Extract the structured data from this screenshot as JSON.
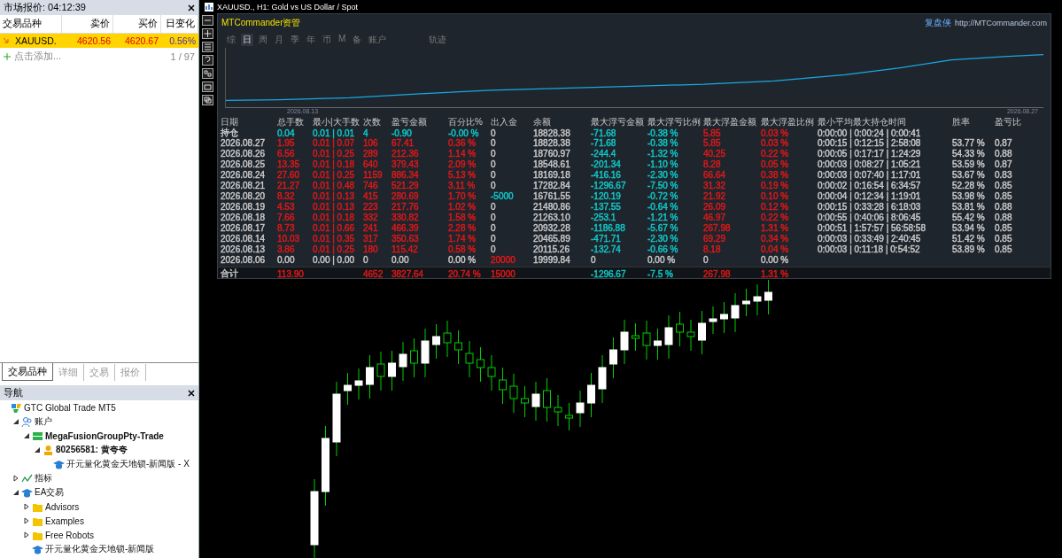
{
  "market_watch": {
    "title": "市场报价: 04:12:39",
    "columns": [
      "交易品种",
      "卖价",
      "买价",
      "日变化"
    ],
    "rows": [
      {
        "symbol": "XAUUSD.",
        "bid": "4620.56",
        "ask": "4620.67",
        "change": "0.56%",
        "selected": true
      }
    ],
    "add_label": "点击添加...",
    "count": "1 / 97"
  },
  "left_tabs": [
    {
      "label": "交易品种",
      "selected": true
    },
    {
      "label": "详细",
      "selected": false
    },
    {
      "label": "交易",
      "selected": false
    },
    {
      "label": "报价",
      "selected": false
    }
  ],
  "navigator": {
    "title": "导航",
    "tree": [
      {
        "label": "GTC Global Trade MT5",
        "kind": "broker",
        "bold": false,
        "children": [
          {
            "label": "账户",
            "kind": "accounts",
            "bold": false,
            "expanded": true,
            "children": [
              {
                "label": "MegaFusionGroupPty-Trade",
                "kind": "server",
                "bold": true,
                "expanded": true,
                "children": [
                  {
                    "label": "80256581: 黄夸夸",
                    "kind": "user",
                    "bold": true,
                    "expanded": true,
                    "children": [
                      {
                        "label": "开元量化黄金天地锁-新闻版 - X",
                        "kind": "expert",
                        "bold": false
                      }
                    ]
                  }
                ]
              }
            ]
          },
          {
            "label": "指标",
            "kind": "indicators",
            "bold": false,
            "expanded": false
          },
          {
            "label": "EA交易",
            "kind": "expert",
            "bold": false,
            "expanded": true,
            "children": [
              {
                "label": "Advisors",
                "kind": "folder",
                "bold": false,
                "expanded": false
              },
              {
                "label": "Examples",
                "kind": "folder",
                "bold": false,
                "expanded": false
              },
              {
                "label": "Free Robots",
                "kind": "folder",
                "bold": false,
                "expanded": false
              },
              {
                "label": "开元量化黄金天地锁-新闻版",
                "kind": "expert",
                "bold": false
              }
            ]
          }
        ]
      }
    ]
  },
  "chart": {
    "title": "XAUUSD., H1:  Gold vs US Dollar / Spot"
  },
  "commander": {
    "title": "MTCommander资管",
    "brand": "复盘侠",
    "url": "http://MTCommander.com",
    "tabs": [
      {
        "label": "综",
        "selected": false
      },
      {
        "label": "日",
        "selected": true
      },
      {
        "label": "周",
        "selected": false
      },
      {
        "label": "月",
        "selected": false
      },
      {
        "label": "季",
        "selected": false
      },
      {
        "label": "年",
        "selected": false
      },
      {
        "label": "币",
        "selected": false
      },
      {
        "label": "M",
        "selected": false
      },
      {
        "label": "备",
        "selected": false
      },
      {
        "label": "账户",
        "selected": false
      },
      {
        "label": "轨迹",
        "selected": false
      }
    ],
    "curve_start": "2026.08.13",
    "curve_end": "2026.08.27",
    "columns": [
      "日期",
      "总手数",
      "最小|大手数",
      "次数",
      "盈亏金额",
      "百分比%",
      "出入金",
      "余额",
      "最大浮亏金额",
      "最大浮亏比例",
      "最大浮盈金额",
      "最大浮盈比例",
      "最小平均最大持仓时间",
      "胜率",
      "盈亏比"
    ],
    "rows": [
      {
        "kind": "open",
        "cells": [
          {
            "text": "持仓",
            "color": "#c8c8c8"
          },
          {
            "text": "0.04",
            "color": "#10c8c8"
          },
          {
            "text": "0.01 | 0.01",
            "color": "#10c8c8"
          },
          {
            "text": "4",
            "color": "#10c8c8"
          },
          {
            "text": "-0.90",
            "color": "#10c8c8"
          },
          {
            "text": "-0.00 %",
            "color": "#10c8c8"
          },
          {
            "text": "0",
            "color": "#c8c8c8"
          },
          {
            "text": "18828.38",
            "color": "#c8c8c8"
          },
          {
            "text": "-71.68",
            "color": "#10c8c8"
          },
          {
            "text": "-0.38 %",
            "color": "#10c8c8"
          },
          {
            "text": "5.85",
            "color": "#e01818"
          },
          {
            "text": "0.03 %",
            "color": "#e01818"
          },
          {
            "text": "0:00:00 | 0:00:24 | 0:00:41",
            "color": "#c8c8c8"
          },
          null,
          null
        ]
      },
      {
        "kind": "day",
        "cells": [
          {
            "text": "2026.08.27",
            "color": "#c8c8c8"
          },
          {
            "text": "1.95",
            "color": "#e01818"
          },
          {
            "text": "0.01 | 0.07",
            "color": "#e01818"
          },
          {
            "text": "106",
            "color": "#e01818"
          },
          {
            "text": "67.41",
            "color": "#e01818"
          },
          {
            "text": "0.36 %",
            "color": "#e01818"
          },
          {
            "text": "0",
            "color": "#c8c8c8"
          },
          {
            "text": "18828.38",
            "color": "#c8c8c8"
          },
          {
            "text": "-71.68",
            "color": "#10c8c8"
          },
          {
            "text": "-0.38 %",
            "color": "#10c8c8"
          },
          {
            "text": "5.85",
            "color": "#e01818"
          },
          {
            "text": "0.03 %",
            "color": "#e01818"
          },
          {
            "text": "0:00:15 | 0:12:15 | 2:58:08",
            "color": "#c8c8c8"
          },
          {
            "text": "53.77 %",
            "color": "#c8c8c8"
          },
          {
            "text": "0.87",
            "color": "#c8c8c8"
          }
        ]
      },
      {
        "kind": "day",
        "cells": [
          {
            "text": "2026.08.26",
            "color": "#c8c8c8"
          },
          {
            "text": "6.56",
            "color": "#e01818"
          },
          {
            "text": "0.01 | 0.25",
            "color": "#e01818"
          },
          {
            "text": "289",
            "color": "#e01818"
          },
          {
            "text": "212.36",
            "color": "#e01818"
          },
          {
            "text": "1.14 %",
            "color": "#e01818"
          },
          {
            "text": "0",
            "color": "#c8c8c8"
          },
          {
            "text": "18760.97",
            "color": "#c8c8c8"
          },
          {
            "text": "-244.4",
            "color": "#10c8c8"
          },
          {
            "text": "-1.32 %",
            "color": "#10c8c8"
          },
          {
            "text": "40.25",
            "color": "#e01818"
          },
          {
            "text": "0.22 %",
            "color": "#e01818"
          },
          {
            "text": "0:00:05 | 0:17:17 | 1:24:29",
            "color": "#c8c8c8"
          },
          {
            "text": "54.33 %",
            "color": "#c8c8c8"
          },
          {
            "text": "0.88",
            "color": "#c8c8c8"
          }
        ]
      },
      {
        "kind": "day",
        "cells": [
          {
            "text": "2026.08.25",
            "color": "#c8c8c8"
          },
          {
            "text": "13.35",
            "color": "#e01818"
          },
          {
            "text": "0.01 | 0.18",
            "color": "#e01818"
          },
          {
            "text": "640",
            "color": "#e01818"
          },
          {
            "text": "379.43",
            "color": "#e01818"
          },
          {
            "text": "2.09 %",
            "color": "#e01818"
          },
          {
            "text": "0",
            "color": "#c8c8c8"
          },
          {
            "text": "18548.61",
            "color": "#c8c8c8"
          },
          {
            "text": "-201.34",
            "color": "#10c8c8"
          },
          {
            "text": "-1.10 %",
            "color": "#10c8c8"
          },
          {
            "text": "8.28",
            "color": "#e01818"
          },
          {
            "text": "0.05 %",
            "color": "#e01818"
          },
          {
            "text": "0:00:03 | 0:08:27 | 1:05:21",
            "color": "#c8c8c8"
          },
          {
            "text": "53.59 %",
            "color": "#c8c8c8"
          },
          {
            "text": "0.87",
            "color": "#c8c8c8"
          }
        ]
      },
      {
        "kind": "day",
        "cells": [
          {
            "text": "2026.08.24",
            "color": "#c8c8c8"
          },
          {
            "text": "27.60",
            "color": "#e01818"
          },
          {
            "text": "0.01 | 0.25",
            "color": "#e01818"
          },
          {
            "text": "1159",
            "color": "#e01818"
          },
          {
            "text": "886.34",
            "color": "#e01818"
          },
          {
            "text": "5.13 %",
            "color": "#e01818"
          },
          {
            "text": "0",
            "color": "#c8c8c8"
          },
          {
            "text": "18169.18",
            "color": "#c8c8c8"
          },
          {
            "text": "-416.16",
            "color": "#10c8c8"
          },
          {
            "text": "-2.30 %",
            "color": "#10c8c8"
          },
          {
            "text": "66.64",
            "color": "#e01818"
          },
          {
            "text": "0.38 %",
            "color": "#e01818"
          },
          {
            "text": "0:00:03 | 0:07:40 | 1:17:01",
            "color": "#c8c8c8"
          },
          {
            "text": "53.67 %",
            "color": "#c8c8c8"
          },
          {
            "text": "0.83",
            "color": "#c8c8c8"
          }
        ]
      },
      {
        "kind": "day",
        "cells": [
          {
            "text": "2026.08.21",
            "color": "#c8c8c8"
          },
          {
            "text": "21.27",
            "color": "#e01818"
          },
          {
            "text": "0.01 | 0.48",
            "color": "#e01818"
          },
          {
            "text": "746",
            "color": "#e01818"
          },
          {
            "text": "521.29",
            "color": "#e01818"
          },
          {
            "text": "3.11 %",
            "color": "#e01818"
          },
          {
            "text": "0",
            "color": "#c8c8c8"
          },
          {
            "text": "17282.84",
            "color": "#c8c8c8"
          },
          {
            "text": "-1296.67",
            "color": "#10c8c8"
          },
          {
            "text": "-7.50 %",
            "color": "#10c8c8"
          },
          {
            "text": "31.32",
            "color": "#e01818"
          },
          {
            "text": "0.19 %",
            "color": "#e01818"
          },
          {
            "text": "0:00:02 | 0:16:54 | 6:34:57",
            "color": "#c8c8c8"
          },
          {
            "text": "52.28 %",
            "color": "#c8c8c8"
          },
          {
            "text": "0.85",
            "color": "#c8c8c8"
          }
        ]
      },
      {
        "kind": "day",
        "cells": [
          {
            "text": "2026.08.20",
            "color": "#c8c8c8"
          },
          {
            "text": "8.32",
            "color": "#e01818"
          },
          {
            "text": "0.01 | 0.13",
            "color": "#e01818"
          },
          {
            "text": "415",
            "color": "#e01818"
          },
          {
            "text": "280.69",
            "color": "#e01818"
          },
          {
            "text": "1.70 %",
            "color": "#e01818"
          },
          {
            "text": "-5000",
            "color": "#10c8c8"
          },
          {
            "text": "16761.55",
            "color": "#c8c8c8"
          },
          {
            "text": "-120.19",
            "color": "#10c8c8"
          },
          {
            "text": "-0.72 %",
            "color": "#10c8c8"
          },
          {
            "text": "21.92",
            "color": "#e01818"
          },
          {
            "text": "0.10 %",
            "color": "#e01818"
          },
          {
            "text": "0:00:04 | 0:12:34 | 1:19:01",
            "color": "#c8c8c8"
          },
          {
            "text": "53.98 %",
            "color": "#c8c8c8"
          },
          {
            "text": "0.85",
            "color": "#c8c8c8"
          }
        ]
      },
      {
        "kind": "day",
        "cells": [
          {
            "text": "2026.08.19",
            "color": "#c8c8c8"
          },
          {
            "text": "4.53",
            "color": "#e01818"
          },
          {
            "text": "0.01 | 0.13",
            "color": "#e01818"
          },
          {
            "text": "223",
            "color": "#e01818"
          },
          {
            "text": "217.76",
            "color": "#e01818"
          },
          {
            "text": "1.02 %",
            "color": "#e01818"
          },
          {
            "text": "0",
            "color": "#c8c8c8"
          },
          {
            "text": "21480.86",
            "color": "#c8c8c8"
          },
          {
            "text": "-137.55",
            "color": "#10c8c8"
          },
          {
            "text": "-0.64 %",
            "color": "#10c8c8"
          },
          {
            "text": "26.09",
            "color": "#e01818"
          },
          {
            "text": "0.12 %",
            "color": "#e01818"
          },
          {
            "text": "0:00:15 | 0:33:28 | 6:18:03",
            "color": "#c8c8c8"
          },
          {
            "text": "53.81 %",
            "color": "#c8c8c8"
          },
          {
            "text": "0.88",
            "color": "#c8c8c8"
          }
        ]
      },
      {
        "kind": "day",
        "cells": [
          {
            "text": "2026.08.18",
            "color": "#c8c8c8"
          },
          {
            "text": "7.66",
            "color": "#e01818"
          },
          {
            "text": "0.01 | 0.18",
            "color": "#e01818"
          },
          {
            "text": "332",
            "color": "#e01818"
          },
          {
            "text": "330.82",
            "color": "#e01818"
          },
          {
            "text": "1.58 %",
            "color": "#e01818"
          },
          {
            "text": "0",
            "color": "#c8c8c8"
          },
          {
            "text": "21263.10",
            "color": "#c8c8c8"
          },
          {
            "text": "-253.1",
            "color": "#10c8c8"
          },
          {
            "text": "-1.21 %",
            "color": "#10c8c8"
          },
          {
            "text": "46.97",
            "color": "#e01818"
          },
          {
            "text": "0.22 %",
            "color": "#e01818"
          },
          {
            "text": "0:00:55 | 0:40:06 | 8:06:45",
            "color": "#c8c8c8"
          },
          {
            "text": "55.42 %",
            "color": "#c8c8c8"
          },
          {
            "text": "0.88",
            "color": "#c8c8c8"
          }
        ]
      },
      {
        "kind": "day",
        "cells": [
          {
            "text": "2026.08.17",
            "color": "#c8c8c8"
          },
          {
            "text": "8.73",
            "color": "#e01818"
          },
          {
            "text": "0.01 | 0.66",
            "color": "#e01818"
          },
          {
            "text": "241",
            "color": "#e01818"
          },
          {
            "text": "466.39",
            "color": "#e01818"
          },
          {
            "text": "2.28 %",
            "color": "#e01818"
          },
          {
            "text": "0",
            "color": "#c8c8c8"
          },
          {
            "text": "20932.28",
            "color": "#c8c8c8"
          },
          {
            "text": "-1186.88",
            "color": "#10c8c8"
          },
          {
            "text": "-5.67 %",
            "color": "#10c8c8"
          },
          {
            "text": "267.98",
            "color": "#e01818"
          },
          {
            "text": "1.31 %",
            "color": "#e01818"
          },
          {
            "text": "0:00:51 | 1:57:57 | 56:58:58",
            "color": "#c8c8c8"
          },
          {
            "text": "53.94 %",
            "color": "#c8c8c8"
          },
          {
            "text": "0.85",
            "color": "#c8c8c8"
          }
        ]
      },
      {
        "kind": "day",
        "cells": [
          {
            "text": "2026.08.14",
            "color": "#c8c8c8"
          },
          {
            "text": "10.03",
            "color": "#e01818"
          },
          {
            "text": "0.01 | 0.35",
            "color": "#e01818"
          },
          {
            "text": "317",
            "color": "#e01818"
          },
          {
            "text": "350.63",
            "color": "#e01818"
          },
          {
            "text": "1.74 %",
            "color": "#e01818"
          },
          {
            "text": "0",
            "color": "#c8c8c8"
          },
          {
            "text": "20465.89",
            "color": "#c8c8c8"
          },
          {
            "text": "-471.71",
            "color": "#10c8c8"
          },
          {
            "text": "-2.30 %",
            "color": "#10c8c8"
          },
          {
            "text": "69.29",
            "color": "#e01818"
          },
          {
            "text": "0.34 %",
            "color": "#e01818"
          },
          {
            "text": "0:00:03 | 0:33:49 | 2:40:45",
            "color": "#c8c8c8"
          },
          {
            "text": "51.42 %",
            "color": "#c8c8c8"
          },
          {
            "text": "0.85",
            "color": "#c8c8c8"
          }
        ]
      },
      {
        "kind": "day",
        "cells": [
          {
            "text": "2026.08.13",
            "color": "#c8c8c8"
          },
          {
            "text": "3.86",
            "color": "#e01818"
          },
          {
            "text": "0.01 | 0.25",
            "color": "#e01818"
          },
          {
            "text": "180",
            "color": "#e01818"
          },
          {
            "text": "115.42",
            "color": "#e01818"
          },
          {
            "text": "0.58 %",
            "color": "#e01818"
          },
          {
            "text": "0",
            "color": "#c8c8c8"
          },
          {
            "text": "20115.26",
            "color": "#c8c8c8"
          },
          {
            "text": "-132.74",
            "color": "#10c8c8"
          },
          {
            "text": "-0.66 %",
            "color": "#10c8c8"
          },
          {
            "text": "8.18",
            "color": "#e01818"
          },
          {
            "text": "0.04 %",
            "color": "#e01818"
          },
          {
            "text": "0:00:03 | 0:11:18 | 0:54:52",
            "color": "#c8c8c8"
          },
          {
            "text": "53.89 %",
            "color": "#c8c8c8"
          },
          {
            "text": "0.85",
            "color": "#c8c8c8"
          }
        ]
      },
      {
        "kind": "day",
        "cells": [
          {
            "text": "2026.08.06",
            "color": "#c8c8c8"
          },
          {
            "text": "0.00",
            "color": "#c8c8c8"
          },
          {
            "text": "0.00 | 0.00",
            "color": "#c8c8c8"
          },
          {
            "text": "0",
            "color": "#c8c8c8"
          },
          {
            "text": "0.00",
            "color": "#c8c8c8"
          },
          {
            "text": "0.00 %",
            "color": "#c8c8c8"
          },
          {
            "text": "20000",
            "color": "#e01818"
          },
          {
            "text": "19999.84",
            "color": "#c8c8c8"
          },
          {
            "text": "0",
            "color": "#c8c8c8"
          },
          {
            "text": "0.00 %",
            "color": "#c8c8c8"
          },
          {
            "text": "0",
            "color": "#c8c8c8"
          },
          {
            "text": "0.00 %",
            "color": "#c8c8c8"
          },
          null,
          null,
          null
        ]
      },
      {
        "kind": "total",
        "cells": [
          {
            "text": "合计",
            "color": "#c8c8c8"
          },
          {
            "text": "113.90",
            "color": "#e01818"
          },
          null,
          {
            "text": "4652",
            "color": "#e01818"
          },
          {
            "text": "3827.64",
            "color": "#e01818"
          },
          {
            "text": "20.74 %",
            "color": "#e01818"
          },
          {
            "text": "15000",
            "color": "#e01818"
          },
          null,
          {
            "text": "-1296.67",
            "color": "#10c8c8"
          },
          {
            "text": "-7.5 %",
            "color": "#10c8c8"
          },
          {
            "text": "267.98",
            "color": "#e01818"
          },
          {
            "text": "1.31 %",
            "color": "#e01818"
          },
          null,
          null,
          null
        ]
      }
    ]
  }
}
